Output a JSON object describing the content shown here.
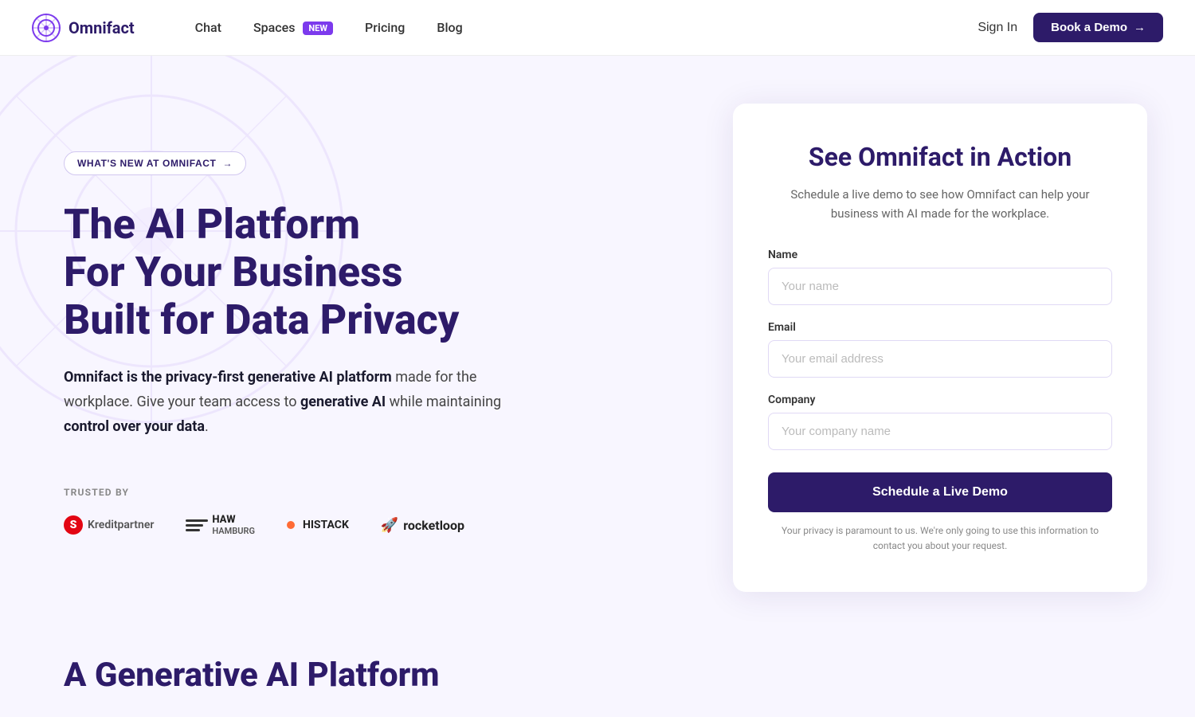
{
  "nav": {
    "logo_text": "Omnifact",
    "links": [
      {
        "label": "Chat",
        "id": "chat",
        "badge": null
      },
      {
        "label": "Spaces",
        "id": "spaces",
        "badge": "NEW"
      },
      {
        "label": "Pricing",
        "id": "pricing",
        "badge": null
      },
      {
        "label": "Blog",
        "id": "blog",
        "badge": null
      }
    ],
    "sign_in": "Sign In",
    "book_demo": "Book a Demo"
  },
  "hero": {
    "whats_new_label": "WHAT'S NEW AT OMNIFACT",
    "title_line1": "The AI Platform",
    "title_line2": "For Your Business",
    "title_line3": "Built for Data Privacy",
    "subtitle_part1": "Omnifact is the privacy-first generative AI platform",
    "subtitle_part2": " made for the workplace. Give your team access to ",
    "subtitle_bold1": "generative AI",
    "subtitle_part3": " while maintaining ",
    "subtitle_bold2": "control over your data",
    "subtitle_end": ".",
    "trusted_label": "TRUSTED BY",
    "trusted_logos": [
      {
        "name": "Kreditpartner",
        "type": "sparkasse"
      },
      {
        "name": "HAW Hamburg",
        "type": "haw"
      },
      {
        "name": "Histack",
        "type": "histack"
      },
      {
        "name": "rocketloop",
        "type": "rocketloop"
      }
    ]
  },
  "form": {
    "title": "See Omnifact in Action",
    "subtitle": "Schedule a live demo to see how Omnifact can help your business with AI made for the workplace.",
    "name_label": "Name",
    "name_placeholder": "Your name",
    "email_label": "Email",
    "email_placeholder": "Your email address",
    "company_label": "Company",
    "company_placeholder": "Your company name",
    "submit_label": "Schedule a Live Demo",
    "privacy_text": "Your privacy is paramount to us. We're only going to use this information to contact you about your request."
  },
  "bottom": {
    "title": "A Generative AI Platform"
  }
}
